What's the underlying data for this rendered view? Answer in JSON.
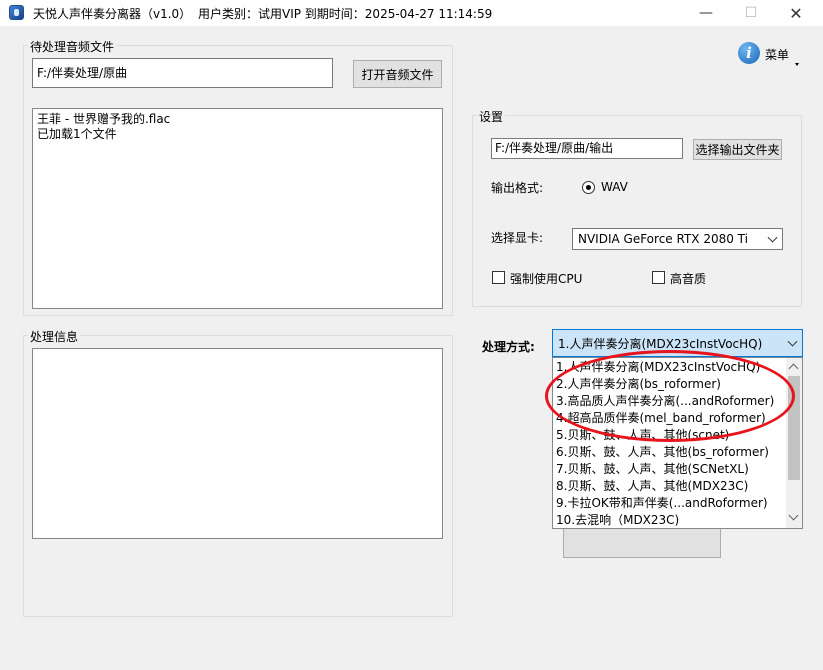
{
  "window": {
    "title": "天悦人声伴奏分离器（v1.0）",
    "user_info": "用户类别：试用VIP 到期时间：2025-04-27 11:14:59",
    "minimize_glyph": "—",
    "maximize_glyph": "☐",
    "close_glyph": "✕"
  },
  "menu": {
    "label": "菜单",
    "icon": "info-icon"
  },
  "input_group": {
    "title": "待处理音频文件",
    "path_value": "F:/伴奏处理/原曲",
    "open_button": "打开音频文件",
    "files": [
      "王菲 - 世界赠予我的.flac",
      "已加载1个文件"
    ]
  },
  "info_group": {
    "title": "处理信息"
  },
  "settings": {
    "title": "设置",
    "output_path": "F:/伴奏处理/原曲/输出",
    "choose_output_button": "选择输出文件夹",
    "format_label": "输出格式:",
    "format_option": "WAV",
    "format_selected": true,
    "gpu_label": "选择显卡:",
    "gpu_value": "NVIDIA GeForce RTX 2080 Ti",
    "force_cpu_label": "强制使用CPU",
    "force_cpu_checked": false,
    "high_quality_label": "高音质",
    "high_quality_checked": false
  },
  "processing": {
    "label": "处理方式:",
    "selected": "1.人声伴奏分离(MDX23cInstVocHQ)",
    "options": [
      "1.人声伴奏分离(MDX23cInstVocHQ)",
      "2.人声伴奏分离(bs_roformer)",
      "3.高品质人声伴奏分离(...andRoformer)",
      "4.超高品质伴奏(mel_band_roformer)",
      "5.贝斯、鼓、人声、其他(scnet)",
      "6.贝斯、鼓、人声、其他(bs_roformer)",
      "7.贝斯、鼓、人声、其他(SCNetXL)",
      "8.贝斯、鼓、人声、其他(MDX23C)",
      "9.卡拉OK带和声伴奏(...andRoformer)",
      "10.去混响（MDX23C)"
    ]
  },
  "colors": {
    "highlight_ellipse": "#e8141c",
    "combo_active": "#cce4f7"
  }
}
